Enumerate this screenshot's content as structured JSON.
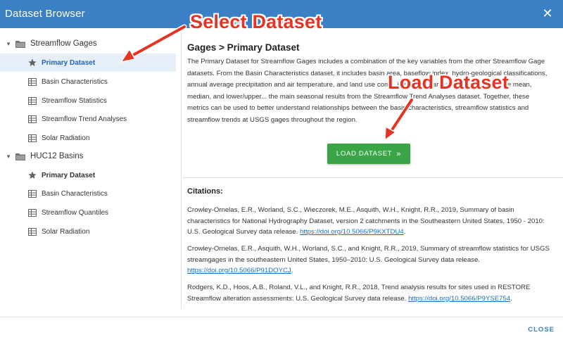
{
  "window": {
    "title": "Dataset Browser",
    "close_glyph": "✕"
  },
  "sidebar": {
    "groups": [
      {
        "label": "Streamflow Gages",
        "items": [
          {
            "label": "Primary Dataset",
            "icon": "star-icon",
            "selected": true
          },
          {
            "label": "Basin Characteristics",
            "icon": "table-icon"
          },
          {
            "label": "Streamflow Statistics",
            "icon": "table-icon"
          },
          {
            "label": "Streamflow Trend Analyses",
            "icon": "table-icon"
          },
          {
            "label": "Solar Radiation",
            "icon": "table-icon"
          }
        ]
      },
      {
        "label": "HUC12 Basins",
        "items": [
          {
            "label": "Primary Dataset",
            "icon": "star-icon"
          },
          {
            "label": "Basin Characteristics",
            "icon": "table-icon"
          },
          {
            "label": "Streamflow Quantiles",
            "icon": "table-icon"
          },
          {
            "label": "Solar Radiation",
            "icon": "table-icon"
          }
        ]
      }
    ]
  },
  "main": {
    "heading": "Gages > Primary Dataset",
    "description": "The Primary Dataset for Streamflow Gages includes a combination of the key variables from the other Streamflow Gage datasets. From the Basin Characteristics dataset, it includes basin area, baseflow index, hydro-geological classifications, annual average precipitation and air temperature, and land use com... it includes various metrics such as the mean, median, and lower/upper... the main seasonal results from the Streamflow Trend Analyses dataset. Together, these metrics can be used to better understand relationships between the basin characteristics, streamflow statistics and streamflow trends at USGS gages throughout the region.",
    "load_button": "LOAD DATASET",
    "load_chevron": "»",
    "citations_title": "Citations:",
    "citations": [
      {
        "text": "Crowley-Ornelas, E.R., Worland, S.C., Wieczorek, M.E., Asquith, W.H., Knight, R.R., 2019, Summary of basin characteristics for National Hydrography Dataset, version 2 catchments in the Southeastern United States, 1950 - 2010: U.S. Geological Survey data release.",
        "link": "https://doi.org/10.5066/P9KXTDU4",
        "tail": "."
      },
      {
        "text": "Crowley-Ornelas, E.R., Asquith, W.H., Worland, S.C., and Knight, R.R., 2019, Summary of streamflow statistics for USGS streamgages in the southeastern United States, 1950–2010: U.S. Geological Survey data release.",
        "link": "https://doi.org/10.5066/P91DOYCJ",
        "tail": "."
      },
      {
        "text": "Rodgers, K.D., Hoos, A.B., Roland, V.L., and Knight, R.R., 2018, Trend analysis results for sites used in RESTORE Streamflow alteration assessments: U.S. Geological Survey data release.",
        "link": "https://doi.org/10.5066/P9YSE754",
        "tail": "."
      }
    ]
  },
  "footer": {
    "close_button": "CLOSE"
  },
  "annotations": {
    "select": "Select Dataset",
    "load": "Load Dataset"
  },
  "colors": {
    "header": "#3b7fc4",
    "button": "#3aa546",
    "annotation": "#e53424",
    "link": "#1a6fc2"
  }
}
